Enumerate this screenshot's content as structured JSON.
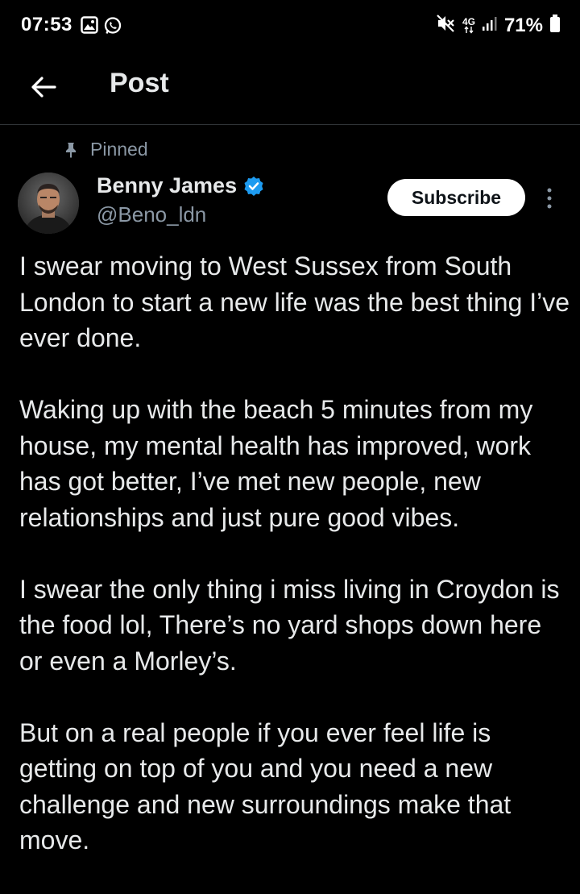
{
  "status_bar": {
    "time": "07:53",
    "network": "4G",
    "battery": "71%"
  },
  "header": {
    "title": "Post"
  },
  "post": {
    "pinned_label": "Pinned",
    "author": {
      "name": "Benny James",
      "handle": "@Beno_ldn",
      "verified": true
    },
    "subscribe_label": "Subscribe",
    "paragraphs": [
      "I swear moving to West Sussex from South London to start a new life was the best thing I’ve ever done.",
      "Waking up with the beach 5 minutes from my house, my mental health has improved, work has got better, I’ve met new people, new relationships and just pure good vibes.",
      "I swear the only thing i miss living in Croydon is the food lol, There’s no yard shops down here or even a Morley’s.",
      "But on a real people if you ever feel life is getting on top of you and you need a new challenge and new surroundings make that move."
    ]
  },
  "colors": {
    "background": "#000000",
    "text_primary": "#e7e9ea",
    "text_secondary": "#8b98a5",
    "verified_badge": "#1d9bf0",
    "subscribe_bg": "#ffffff",
    "divider": "#2f3336"
  },
  "icons": {
    "back": "arrow-left-icon",
    "pin": "pin-icon",
    "verified": "verified-badge-icon",
    "more": "more-vertical-icon",
    "gallery": "gallery-icon",
    "whatsapp": "whatsapp-icon",
    "mute": "mute-icon",
    "signal": "signal-icon",
    "battery": "battery-icon"
  }
}
